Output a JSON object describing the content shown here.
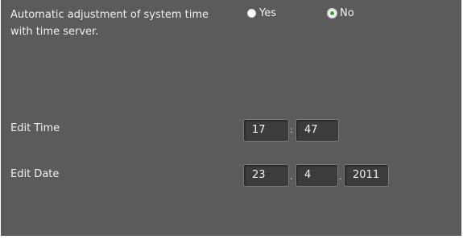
{
  "auto_adjust": {
    "label": "Automatic adjustment of system time with time server.",
    "options": [
      {
        "label": "Yes",
        "selected": false
      },
      {
        "label": "No",
        "selected": true
      }
    ]
  },
  "edit_time": {
    "label": "Edit Time",
    "hour": "17",
    "separator": ":",
    "minute": "47"
  },
  "edit_date": {
    "label": "Edit Date",
    "day": "23",
    "separator": ".",
    "month": "4",
    "year": "2011"
  }
}
